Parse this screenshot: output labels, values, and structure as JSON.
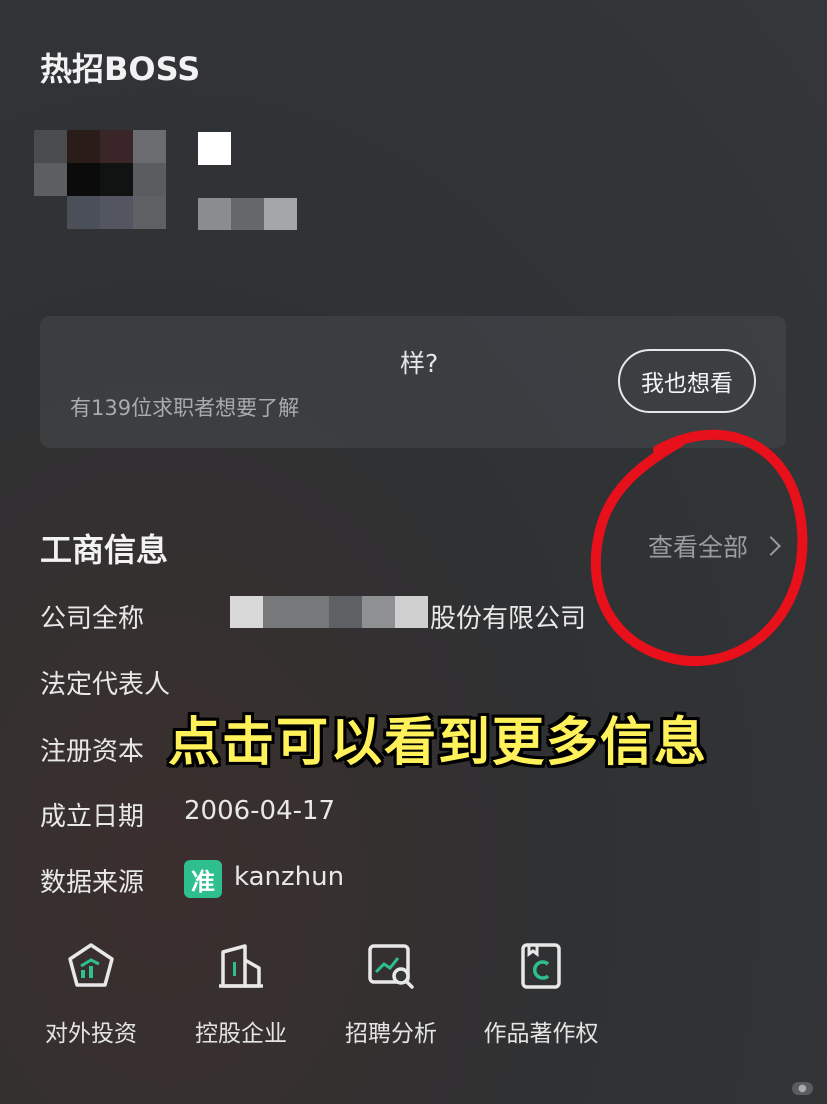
{
  "header": {
    "title": "热招BOSS"
  },
  "card": {
    "question_suffix": "样?",
    "subtitle": "有139位求职者想要了解",
    "button_label": "我也想看"
  },
  "business_info": {
    "title": "工商信息",
    "view_all_label": "查看全部",
    "rows": {
      "company_name_label": "公司全称",
      "company_name_suffix": "股份有限公司",
      "legal_rep_label": "法定代表人",
      "capital_label": "注册资本",
      "founded_label": "成立日期",
      "founded_value": "2006-04-17",
      "source_label": "数据来源",
      "source_badge": "准",
      "source_value": "kanzhun"
    }
  },
  "overlay": {
    "caption": "点击可以看到更多信息"
  },
  "bottom_icons": [
    {
      "label": "对外投资",
      "icon": "investment-icon"
    },
    {
      "label": "控股企业",
      "icon": "holding-building-icon"
    },
    {
      "label": "招聘分析",
      "icon": "recruit-analysis-icon"
    },
    {
      "label": "作品著作权",
      "icon": "copyright-icon"
    }
  ],
  "colors": {
    "accent_green": "#2fbf8e",
    "annotation_red": "#e8101a",
    "caption_yellow": "#fff15a"
  }
}
